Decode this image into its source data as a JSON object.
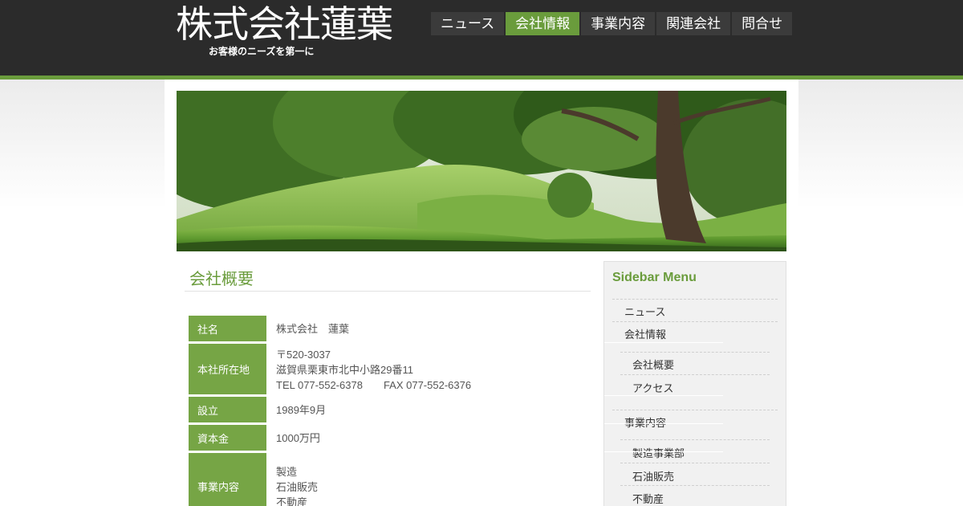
{
  "header": {
    "site_title": "株式会社蓮葉",
    "tagline": "お客様のニーズを第一に"
  },
  "nav": {
    "items": [
      {
        "label": "ニュース",
        "active": false
      },
      {
        "label": "会社情報",
        "active": true
      },
      {
        "label": "事業内容",
        "active": false
      },
      {
        "label": "関連会社",
        "active": false
      },
      {
        "label": "問合せ",
        "active": false
      }
    ]
  },
  "main": {
    "heading": "会社概要",
    "rows": [
      {
        "label": "社名",
        "value": "株式会社　蓮葉"
      },
      {
        "label": "本社所在地",
        "postal": "〒520-3037",
        "address": "滋賀県栗東市北中小路29番11",
        "tel": "TEL 077-552-6378",
        "fax": "FAX 077-552-6376"
      },
      {
        "label": "設立",
        "value": "1989年9月"
      },
      {
        "label": "資本金",
        "value": "1000万円"
      },
      {
        "label": "事業内容",
        "lines": [
          "製造",
          "石油販売",
          "不動産"
        ]
      }
    ]
  },
  "sidebar": {
    "title": "Sidebar Menu",
    "items": [
      {
        "label": "ニュース"
      },
      {
        "label": "会社情報"
      },
      {
        "label": "会社概要"
      },
      {
        "label": "アクセス"
      },
      {
        "label": "事業内容"
      },
      {
        "label": "製造事業部"
      },
      {
        "label": "石油販売"
      },
      {
        "label": "不動産"
      }
    ]
  },
  "colors": {
    "accent_green": "#6a9c3c",
    "header_dark": "#2b2b2b",
    "nav_dark": "#3b3b3b"
  }
}
